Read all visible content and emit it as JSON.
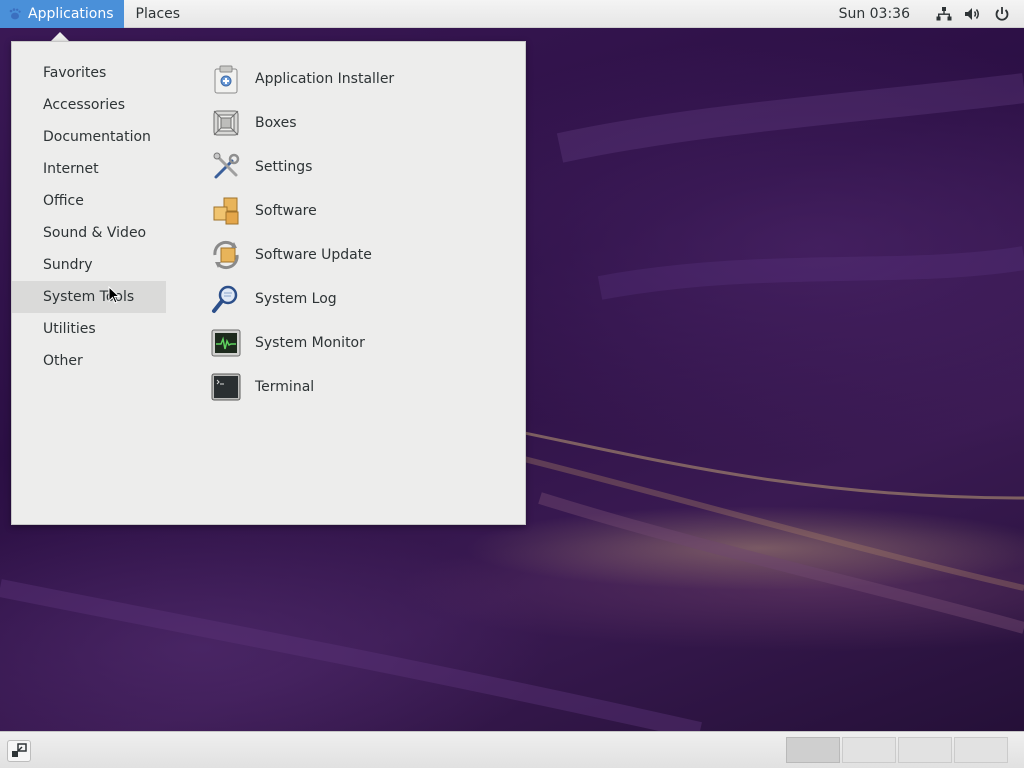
{
  "topbar": {
    "applications_label": "Applications",
    "places_label": "Places",
    "clock": "Sun 03:36"
  },
  "menu": {
    "categories": [
      {
        "label": "Favorites"
      },
      {
        "label": "Accessories"
      },
      {
        "label": "Documentation"
      },
      {
        "label": "Internet"
      },
      {
        "label": "Office"
      },
      {
        "label": "Sound & Video"
      },
      {
        "label": "Sundry"
      },
      {
        "label": "System Tools",
        "selected": true
      },
      {
        "label": "Utilities"
      },
      {
        "label": "Other"
      }
    ],
    "apps": [
      {
        "label": "Application Installer",
        "icon": "application-installer-icon"
      },
      {
        "label": "Boxes",
        "icon": "boxes-icon"
      },
      {
        "label": "Settings",
        "icon": "settings-icon"
      },
      {
        "label": "Software",
        "icon": "software-icon"
      },
      {
        "label": "Software Update",
        "icon": "software-update-icon"
      },
      {
        "label": "System Log",
        "icon": "system-log-icon"
      },
      {
        "label": "System Monitor",
        "icon": "system-monitor-icon"
      },
      {
        "label": "Terminal",
        "icon": "terminal-icon"
      }
    ]
  },
  "bottombar": {
    "workspaces": 4,
    "active_workspace": 1
  },
  "colors": {
    "accent": "#4a90d9",
    "menu_bg": "#ededec",
    "selected_bg": "#dadad9"
  }
}
